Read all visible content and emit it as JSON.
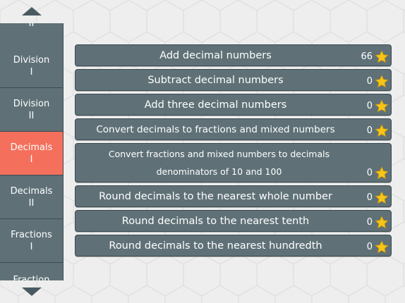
{
  "sidebar": {
    "items": [
      {
        "line1": "",
        "line2": "II"
      },
      {
        "line1": "Division",
        "line2": "I"
      },
      {
        "line1": "Division",
        "line2": "II"
      },
      {
        "line1": "Decimals",
        "line2": "I"
      },
      {
        "line1": "Decimals",
        "line2": "II"
      },
      {
        "line1": "Fractions",
        "line2": "I"
      },
      {
        "line1": "Fraction",
        "line2": ""
      }
    ],
    "active_index": 3
  },
  "skills": [
    {
      "title": "Add decimal numbers",
      "score": "66"
    },
    {
      "title": "Subtract decimal numbers",
      "score": "0"
    },
    {
      "title": "Add three decimal numbers",
      "score": "0"
    },
    {
      "title": "Convert decimals to fractions and mixed numbers",
      "score": "0"
    },
    {
      "title": "Convert fractions and mixed numbers to decimals",
      "subtitle": "denominators of 10 and 100",
      "score": "0"
    },
    {
      "title": "Round decimals to the nearest whole number",
      "score": "0"
    },
    {
      "title": "Round decimals to the nearest tenth",
      "score": "0"
    },
    {
      "title": "Round decimals to the nearest hundredth",
      "score": "0"
    }
  ],
  "icons": {
    "scroll_up": "triangle-up-icon",
    "scroll_down": "triangle-down-icon",
    "score": "star-icon"
  },
  "colors": {
    "accent": "#f4705c",
    "tile": "#5f7177",
    "star": "#f6c515"
  }
}
